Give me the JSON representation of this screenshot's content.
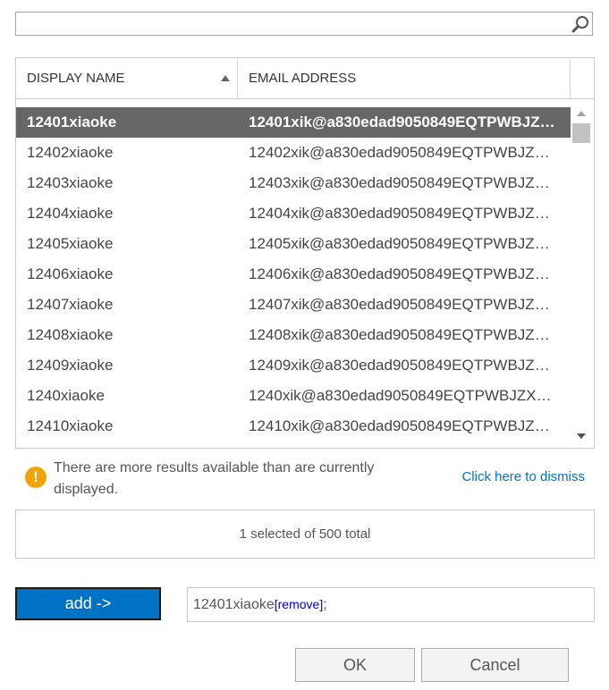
{
  "search": {
    "value": "",
    "placeholder": "",
    "icon": "search-icon"
  },
  "grid": {
    "columns": [
      {
        "label": "DISPLAY NAME",
        "sort": "ascending"
      },
      {
        "label": "EMAIL ADDRESS"
      }
    ],
    "rows": [
      {
        "name": "12401xiaoke",
        "email": "12401xik@a830edad9050849EQTPWBJZX…",
        "selected": true
      },
      {
        "name": "12402xiaoke",
        "email": "12402xik@a830edad9050849EQTPWBJZX…",
        "selected": false
      },
      {
        "name": "12403xiaoke",
        "email": "12403xik@a830edad9050849EQTPWBJZX…",
        "selected": false
      },
      {
        "name": "12404xiaoke",
        "email": "12404xik@a830edad9050849EQTPWBJZX…",
        "selected": false
      },
      {
        "name": "12405xiaoke",
        "email": "12405xik@a830edad9050849EQTPWBJZX…",
        "selected": false
      },
      {
        "name": "12406xiaoke",
        "email": "12406xik@a830edad9050849EQTPWBJZX…",
        "selected": false
      },
      {
        "name": "12407xiaoke",
        "email": "12407xik@a830edad9050849EQTPWBJZX…",
        "selected": false
      },
      {
        "name": "12408xiaoke",
        "email": "12408xik@a830edad9050849EQTPWBJZX…",
        "selected": false
      },
      {
        "name": "12409xiaoke",
        "email": "12409xik@a830edad9050849EQTPWBJZX…",
        "selected": false
      },
      {
        "name": "1240xiaoke",
        "email": "1240xik@a830edad9050849EQTPWBJZXO…",
        "selected": false
      },
      {
        "name": "12410xiaoke",
        "email": "12410xik@a830edad9050849EQTPWBJZX…",
        "selected": false
      }
    ]
  },
  "notice": {
    "text": "There are more results available than are currently displayed.",
    "dismiss_label": "Click here to dismiss",
    "icon": "warning-icon",
    "icon_glyph": "!"
  },
  "status": {
    "text": "1 selected of 500 total"
  },
  "add_button": {
    "label": "add ->"
  },
  "selection": {
    "name": "12401xiaoke",
    "remove_label": "[remove]",
    "separator": ";"
  },
  "footer": {
    "ok_label": "OK",
    "cancel_label": "Cancel"
  },
  "colors": {
    "accent": "#0072c6",
    "selected_row": "#666666",
    "warning": "#f0a30a",
    "link": "#0072c6"
  }
}
